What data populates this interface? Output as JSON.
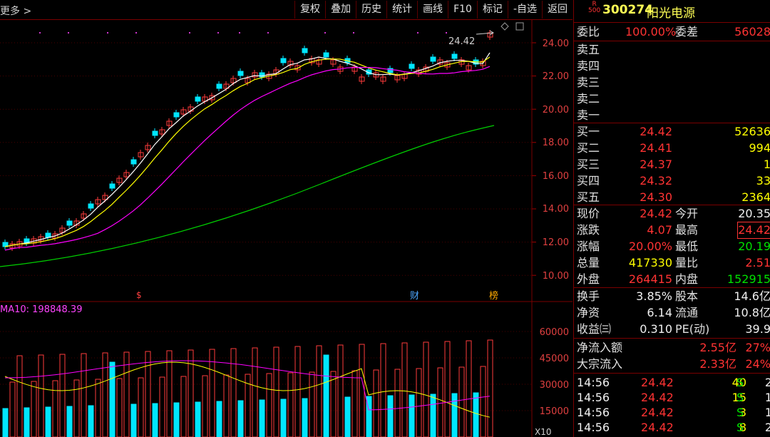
{
  "toolbar": {
    "more": "更多 >",
    "buttons": [
      "复权",
      "叠加",
      "历史",
      "统计",
      "画线",
      "F10",
      "标记",
      "-自选",
      "返回"
    ]
  },
  "kline": {
    "price_ticks": [
      "24.00",
      "22.00",
      "20.00",
      "18.00",
      "16.00",
      "14.00",
      "12.00",
      "10.00"
    ],
    "high_label": "24.42",
    "markers": {
      "s": "$",
      "cai": "财",
      "bang": "榜"
    },
    "colors": {
      "up": "#ff3b3b",
      "down": "#00e6ff",
      "ma5": "#ffffff",
      "ma10": "#ffff00",
      "ma20": "#ff00ff",
      "ma60": "#00d000"
    }
  },
  "volume": {
    "ma_label": "MA10: 198848.39",
    "ticks": [
      "60000",
      "45000",
      "30000",
      "15000"
    ],
    "unit": "X10"
  },
  "quote": {
    "badge_top": "R",
    "badge_bottom": "500",
    "code": "300274",
    "name": "阳光电源",
    "weibi_label": "委比",
    "weibi": "100.00%",
    "weicha_label": "委差",
    "weicha": "56028",
    "sell": [
      {
        "label": "卖五"
      },
      {
        "label": "卖四"
      },
      {
        "label": "卖三"
      },
      {
        "label": "卖二"
      },
      {
        "label": "卖一"
      }
    ],
    "buy": [
      {
        "label": "买一",
        "price": "24.42",
        "vol": "52636"
      },
      {
        "label": "买二",
        "price": "24.41",
        "vol": "994"
      },
      {
        "label": "买三",
        "price": "24.37",
        "vol": "1"
      },
      {
        "label": "买四",
        "price": "24.32",
        "vol": "33"
      },
      {
        "label": "买五",
        "price": "24.30",
        "vol": "2364"
      }
    ],
    "stats": [
      {
        "l1": "现价",
        "v1": "24.42",
        "l2": "今开",
        "v2": "20.35"
      },
      {
        "l1": "涨跌",
        "v1": "4.07",
        "l2": "最高",
        "v2": "24.42"
      },
      {
        "l1": "涨幅",
        "v1": "20.00%",
        "l2": "最低",
        "v2": "20.19"
      },
      {
        "l1": "总量",
        "v1": "417330",
        "l2": "量比",
        "v2": "2.51"
      },
      {
        "l1": "外盘",
        "v1": "264415",
        "l2": "内盘",
        "v2": "152915"
      }
    ],
    "fund": [
      {
        "l1": "换手",
        "v1": "3.85%",
        "l2": "股本",
        "v2": "14.6亿"
      },
      {
        "l1": "净资",
        "v1": "6.14",
        "l2": "流通",
        "v2": "10.8亿"
      },
      {
        "l1": "收益㈢",
        "v1": "0.310",
        "l2": "PE(动)",
        "v2": "39.9"
      }
    ],
    "flow": [
      {
        "label": "净流入额",
        "amount": "2.55亿",
        "pct": "27%"
      },
      {
        "label": "大宗流入",
        "amount": "2.33亿",
        "pct": "24%"
      }
    ],
    "ticks": [
      {
        "time": "14:56",
        "price": "24.42",
        "vol": "40",
        "side": "S",
        "n": "2"
      },
      {
        "time": "14:56",
        "price": "24.42",
        "vol": "15",
        "side": "S",
        "n": "1"
      },
      {
        "time": "14:56",
        "price": "24.42",
        "vol": "3",
        "side": "S",
        "n": "1"
      },
      {
        "time": "14:56",
        "price": "24.42",
        "vol": "8",
        "side": "S",
        "n": "2"
      }
    ]
  }
}
